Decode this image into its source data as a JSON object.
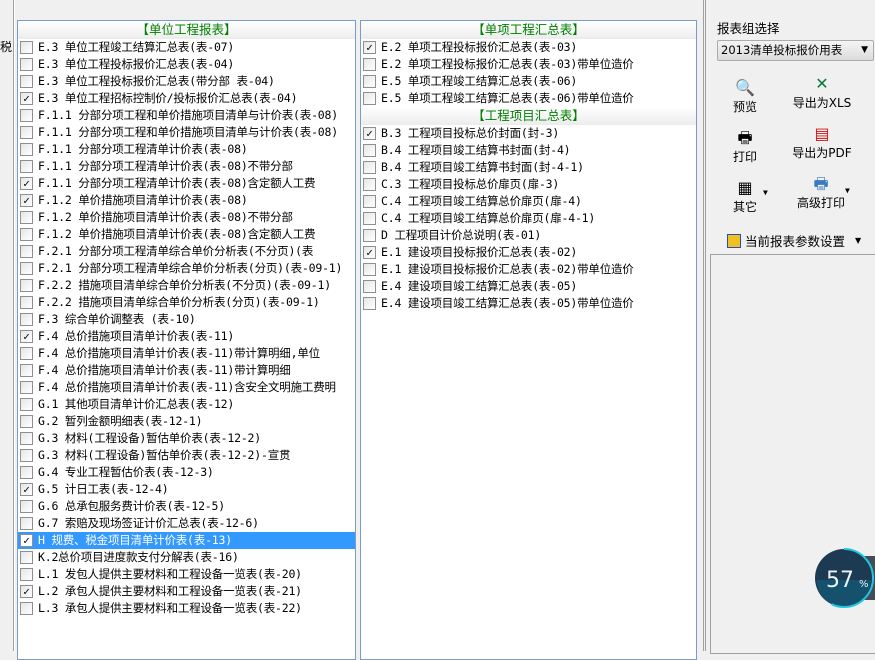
{
  "left_stub_text": "税",
  "unit_panel": {
    "header": "【单位工程报表】",
    "items": [
      {
        "label": "E.3 单位工程竣工结算汇总表(表-07)",
        "checked": false
      },
      {
        "label": "E.3 单位工程投标报价汇总表(表-04)",
        "checked": false
      },
      {
        "label": "E.3 单位工程投标报价汇总表(带分部 表-04)",
        "checked": false
      },
      {
        "label": "E.3 单位工程招标控制价/投标报价汇总表(表-04)",
        "checked": true
      },
      {
        "label": "F.1.1 分部分项工程和单价措施项目清单与计价表(表-08)",
        "checked": false
      },
      {
        "label": "F.1.1 分部分项工程和单价措施项目清单与计价表(表-08)",
        "checked": false
      },
      {
        "label": "F.1.1 分部分项工程清单计价表(表-08)",
        "checked": false
      },
      {
        "label": "F.1.1 分部分项工程清单计价表(表-08)不带分部",
        "checked": false
      },
      {
        "label": "F.1.1 分部分项工程清单计价表(表-08)含定额人工费",
        "checked": true
      },
      {
        "label": "F.1.2 单价措施项目清单计价表(表-08)",
        "checked": true
      },
      {
        "label": "F.1.2 单价措施项目清单计价表(表-08)不带分部",
        "checked": false
      },
      {
        "label": "F.1.2 单价措施项目清单计价表(表-08)含定额人工费",
        "checked": false
      },
      {
        "label": "F.2.1 分部分项工程清单综合单价分析表(不分页)(表",
        "checked": false
      },
      {
        "label": "F.2.1 分部分项工程清单综合单价分析表(分页)(表-09-1)",
        "checked": false
      },
      {
        "label": "F.2.2 措施项目清单综合单价分析表(不分页)(表-09-1)",
        "checked": false
      },
      {
        "label": "F.2.2 措施项目清单综合单价分析表(分页)(表-09-1)",
        "checked": false
      },
      {
        "label": "F.3 综合单价调整表 (表-10)",
        "checked": false
      },
      {
        "label": "F.4 总价措施项目清单计价表(表-11)",
        "checked": true
      },
      {
        "label": "F.4 总价措施项目清单计价表(表-11)带计算明细,单位",
        "checked": false
      },
      {
        "label": "F.4 总价措施项目清单计价表(表-11)带计算明细",
        "checked": false
      },
      {
        "label": "F.4 总价措施项目清单计价表(表-11)含安全文明施工费明",
        "checked": false
      },
      {
        "label": "G.1 其他项目清单计价汇总表(表-12)",
        "checked": false
      },
      {
        "label": "G.2 暂列金额明细表(表-12-1)",
        "checked": false
      },
      {
        "label": "G.3 材料(工程设备)暂估单价表(表-12-2)",
        "checked": false
      },
      {
        "label": "G.3 材料(工程设备)暂估单价表(表-12-2)-宣贯",
        "checked": false
      },
      {
        "label": "G.4 专业工程暂估价表(表-12-3)",
        "checked": false
      },
      {
        "label": "G.5 计日工表(表-12-4)",
        "checked": true
      },
      {
        "label": "G.6 总承包服务费计价表(表-12-5)",
        "checked": false
      },
      {
        "label": "G.7 索赔及现场签证计价汇总表(表-12-6)",
        "checked": false
      },
      {
        "label": "H 规费、税金项目清单计价表(表-13)",
        "checked": true,
        "selected": true
      },
      {
        "label": "K.2总价项目进度款支付分解表(表-16)",
        "checked": false
      },
      {
        "label": "L.1 发包人提供主要材料和工程设备一览表(表-20)",
        "checked": false
      },
      {
        "label": "L.2 承包人提供主要材料和工程设备一览表(表-21)",
        "checked": true
      },
      {
        "label": "L.3 承包人提供主要材料和工程设备一览表(表-22)",
        "checked": false
      }
    ]
  },
  "single_panel": {
    "header": "【单项工程汇总表】",
    "items": [
      {
        "label": "E.2 单项工程投标报价汇总表(表-03)",
        "checked": true
      },
      {
        "label": "E.2 单项工程投标报价汇总表(表-03)带单位造价",
        "checked": false
      },
      {
        "label": "E.5 单项工程竣工结算汇总表(表-06)",
        "checked": false
      },
      {
        "label": "E.5 单项工程竣工结算汇总表(表-06)带单位造价",
        "checked": false
      }
    ]
  },
  "project_panel": {
    "header": "【工程项目汇总表】",
    "items": [
      {
        "label": "B.3 工程项目投标总价封面(封-3)",
        "checked": true
      },
      {
        "label": "B.4 工程项目竣工结算书封面(封-4)",
        "checked": false
      },
      {
        "label": "B.4 工程项目竣工结算书封面(封-4-1)",
        "checked": false
      },
      {
        "label": "C.3 工程项目投标总价扉页(扉-3)",
        "checked": false
      },
      {
        "label": "C.4 工程项目竣工结算总价扉页(扉-4)",
        "checked": false
      },
      {
        "label": "C.4 工程项目竣工结算总价扉页(扉-4-1)",
        "checked": false
      },
      {
        "label": "D 工程项目计价总说明(表-01)",
        "checked": false
      },
      {
        "label": "E.1 建设项目投标报价汇总表(表-02)",
        "checked": true
      },
      {
        "label": "E.1 建设项目投标报价汇总表(表-02)带单位造价",
        "checked": false
      },
      {
        "label": "E.4 建设项目竣工结算汇总表(表-05)",
        "checked": false
      },
      {
        "label": "E.4 建设项目竣工结算汇总表(表-05)带单位造价",
        "checked": false
      }
    ]
  },
  "right": {
    "group_label": "报表组选择",
    "group_value": "2013清单投标报价用表",
    "preview": "预览",
    "export_xls": "导出为XLS",
    "print": "打印",
    "export_pdf": "导出为PDF",
    "other": "其它",
    "advanced_print": "高级打印",
    "params": "当前报表参数设置"
  },
  "gauge": {
    "value": "57",
    "unit": "%",
    "percent": 57,
    "color": "#1fc6e0"
  }
}
